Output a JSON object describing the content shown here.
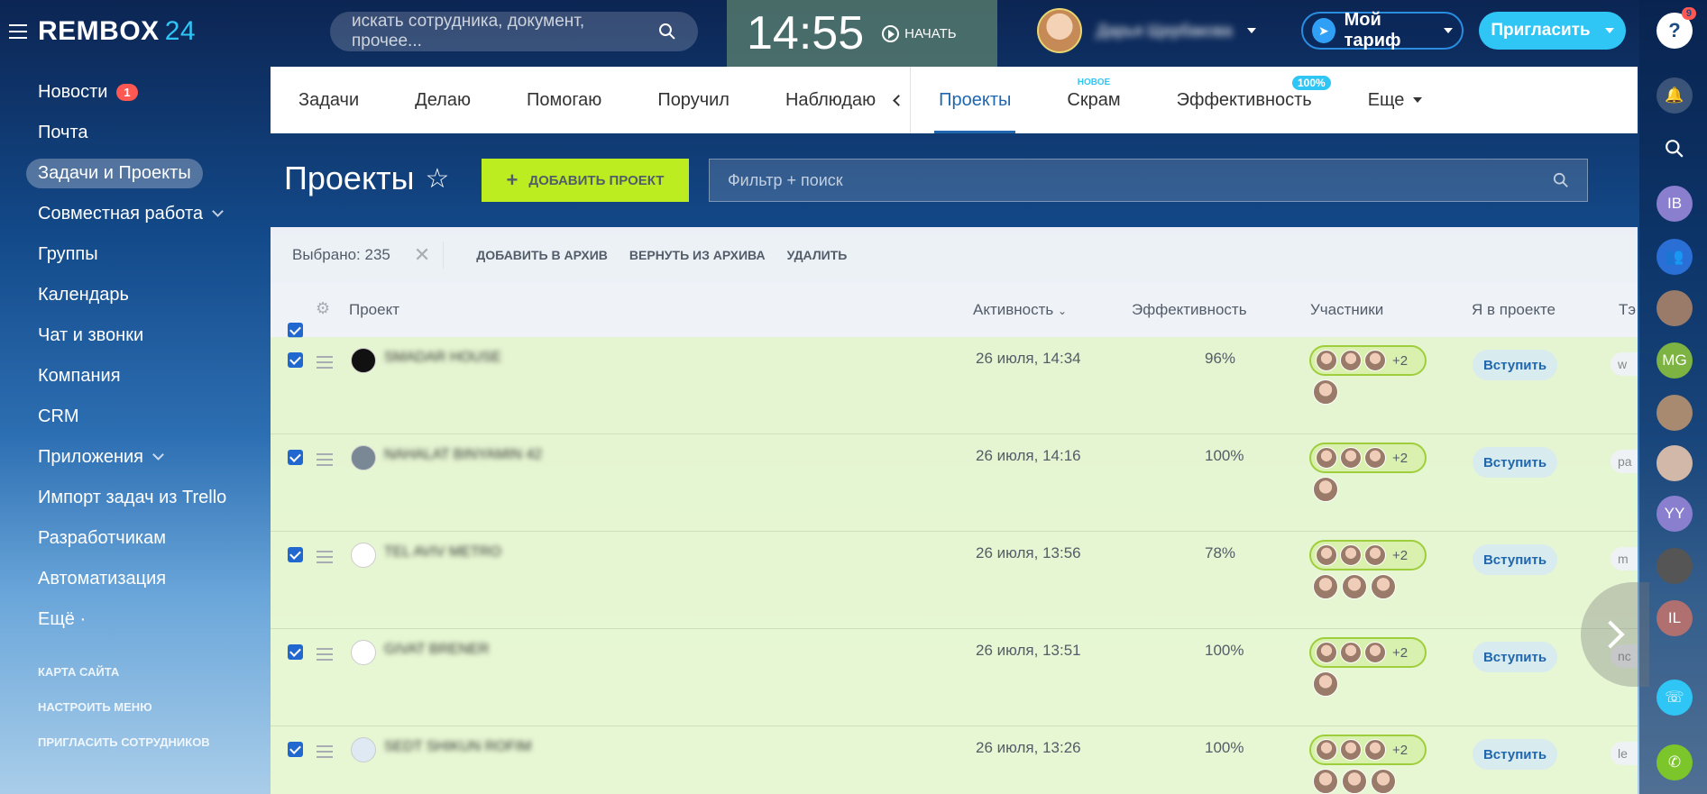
{
  "app": {
    "logo_main": "REMBOX",
    "logo_num": "24"
  },
  "top": {
    "search_placeholder": "искать сотрудника, документ, прочее...",
    "clock_time": "14:55",
    "clock_start": "НАЧАТЬ",
    "user_name": "Дарья Щербакова",
    "tariff_label": "Мой тариф",
    "invite_label": "Пригласить"
  },
  "sidebar": {
    "items": [
      {
        "label": "Новости",
        "counter": "1"
      },
      {
        "label": "Почта"
      },
      {
        "label": "Задачи и Проекты",
        "active": true
      },
      {
        "label": "Совместная работа",
        "chevron": true
      },
      {
        "label": "Группы"
      },
      {
        "label": "Календарь"
      },
      {
        "label": "Чат и звонки"
      },
      {
        "label": "Компания"
      },
      {
        "label": "CRM"
      },
      {
        "label": "Приложения",
        "chevron": true
      },
      {
        "label": "Импорт задач из Trello"
      },
      {
        "label": "Разработчикам"
      },
      {
        "label": "Автоматизация"
      },
      {
        "label": "Ещё ·"
      }
    ],
    "small_links": [
      "КАРТА САЙТА",
      "НАСТРОИТЬ МЕНЮ",
      "ПРИГЛАСИТЬ СОТРУДНИКОВ"
    ]
  },
  "tabs": {
    "items": [
      "Задачи",
      "Делаю",
      "Помогаю",
      "Поручил",
      "Наблюдаю"
    ],
    "projects": "Проекты",
    "scrum": "Скрам",
    "scrum_badge": "НОВОЕ",
    "efficiency": "Эффективность",
    "efficiency_badge": "100%",
    "more": "Еще"
  },
  "page": {
    "title": "Проекты",
    "add_button": "ДОБАВИТЬ ПРОЕКТ",
    "filter_placeholder": "Фильтр + поиск"
  },
  "actions": {
    "selected": "Выбрано: 235",
    "archive": "ДОБАВИТЬ В АРХИВ",
    "restore": "ВЕРНУТЬ ИЗ АРХИВА",
    "delete": "УДАЛИТЬ"
  },
  "table": {
    "headers": {
      "project": "Проект",
      "activity": "Активность",
      "efficiency": "Эффективность",
      "members": "Участники",
      "me": "Я в проекте",
      "tags": "Тэ"
    },
    "rows": [
      {
        "name": "SMADAR HOUSE",
        "date": "26 июля, 14:34",
        "eff": "96%",
        "plus": "+2",
        "join": "Вступить",
        "tag": "w"
      },
      {
        "name": "NAHALAT BINYAMIN 42",
        "date": "26 июля, 14:16",
        "eff": "100%",
        "plus": "+2",
        "join": "Вступить",
        "tag": "pa"
      },
      {
        "name": "TEL AVIV METRO",
        "date": "26 июля, 13:56",
        "eff": "78%",
        "plus": "+2",
        "join": "Вступить",
        "tag": "m"
      },
      {
        "name": "GIVAT BRENER",
        "date": "26 июля, 13:51",
        "eff": "100%",
        "plus": "+2",
        "join": "Вступить",
        "tag": "nc"
      },
      {
        "name": "SEDT SHIKUN ROFIM",
        "date": "26 июля, 13:26",
        "eff": "100%",
        "plus": "+2",
        "join": "Вступить",
        "tag": "le"
      }
    ]
  },
  "rightbar": {
    "help_badge": "9",
    "initials": [
      "IB",
      "MG",
      "YY",
      "IL"
    ]
  },
  "colors": {
    "accent": "#2fc6f6",
    "add_button": "#bbed21",
    "row_bg": "#e2f5c4",
    "badge_red": "#ff5752"
  }
}
